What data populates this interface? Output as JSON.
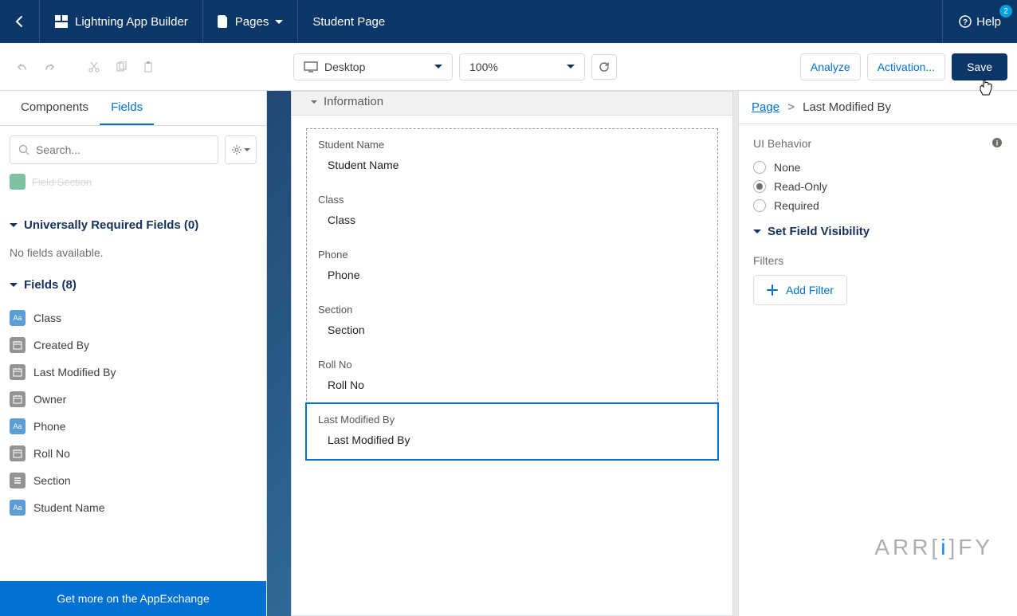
{
  "nav": {
    "app_title": "Lightning App Builder",
    "pages_label": "Pages",
    "page_name": "Student Page",
    "help_label": "Help",
    "help_badge": "2"
  },
  "toolbar": {
    "device": "Desktop",
    "zoom": "100%",
    "analyze": "Analyze",
    "activation": "Activation...",
    "save": "Save"
  },
  "left": {
    "tab_components": "Components",
    "tab_fields": "Fields",
    "search_placeholder": "Search...",
    "remnant_label": "Field Section",
    "universal_hdr": "Universally Required Fields (0)",
    "no_fields": "No fields available.",
    "fields_hdr": "Fields (8)",
    "fields": [
      {
        "label": "Class",
        "type": "text"
      },
      {
        "label": "Created By",
        "type": "date"
      },
      {
        "label": "Last Modified By",
        "type": "date"
      },
      {
        "label": "Owner",
        "type": "date"
      },
      {
        "label": "Phone",
        "type": "text"
      },
      {
        "label": "Roll No",
        "type": "date"
      },
      {
        "label": "Section",
        "type": "pick"
      },
      {
        "label": "Student Name",
        "type": "text"
      }
    ],
    "appex": "Get more on the AppExchange"
  },
  "canvas": {
    "info_header": "Information",
    "fields": [
      {
        "label": "Student Name",
        "value": "Student Name"
      },
      {
        "label": "Class",
        "value": "Class"
      },
      {
        "label": "Phone",
        "value": "Phone"
      },
      {
        "label": "Section",
        "value": "Section"
      },
      {
        "label": "Roll No",
        "value": "Roll No"
      },
      {
        "label": "Last Modified By",
        "value": "Last Modified By",
        "selected": true
      }
    ]
  },
  "right": {
    "breadcrumb_page": "Page",
    "breadcrumb_current": "Last Modified By",
    "ui_behavior": "UI Behavior",
    "opt_none": "None",
    "opt_readonly": "Read-Only",
    "opt_required": "Required",
    "visibility": "Set Field Visibility",
    "filters": "Filters",
    "add_filter": "Add Filter"
  },
  "watermark": {
    "pre": "ARR[",
    "i": "i",
    "post": "]FY"
  }
}
